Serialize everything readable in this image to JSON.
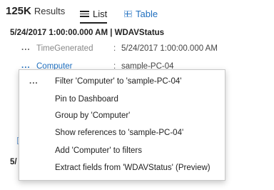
{
  "header": {
    "count": "125K",
    "results_label": "Results",
    "tabs": [
      {
        "label": "List",
        "active": true
      },
      {
        "label": "Table",
        "active": false
      }
    ]
  },
  "record": {
    "title": "5/24/2017 1:00:00.000 AM | WDAVStatus",
    "fields": [
      {
        "dots": "...",
        "name": "TimeGenerated",
        "colon": ":",
        "value": "5/24/2017 1:00:00.000 AM"
      },
      {
        "dots": "...",
        "name": "Computer",
        "colon": ":",
        "value": "sample-PC-04"
      }
    ]
  },
  "next_record_partial": "5/",
  "context_menu": {
    "dots": "...",
    "items": [
      "Filter 'Computer' to 'sample-PC-04'",
      "Pin to Dashboard",
      "Group by 'Computer'",
      "Show references to 'sample-PC-04'",
      "Add 'Computer' to filters",
      "Extract fields from 'WDAVStatus' (Preview)"
    ]
  },
  "colors": {
    "accent": "#1f6fbf",
    "text": "#222222",
    "muted": "#888888"
  }
}
